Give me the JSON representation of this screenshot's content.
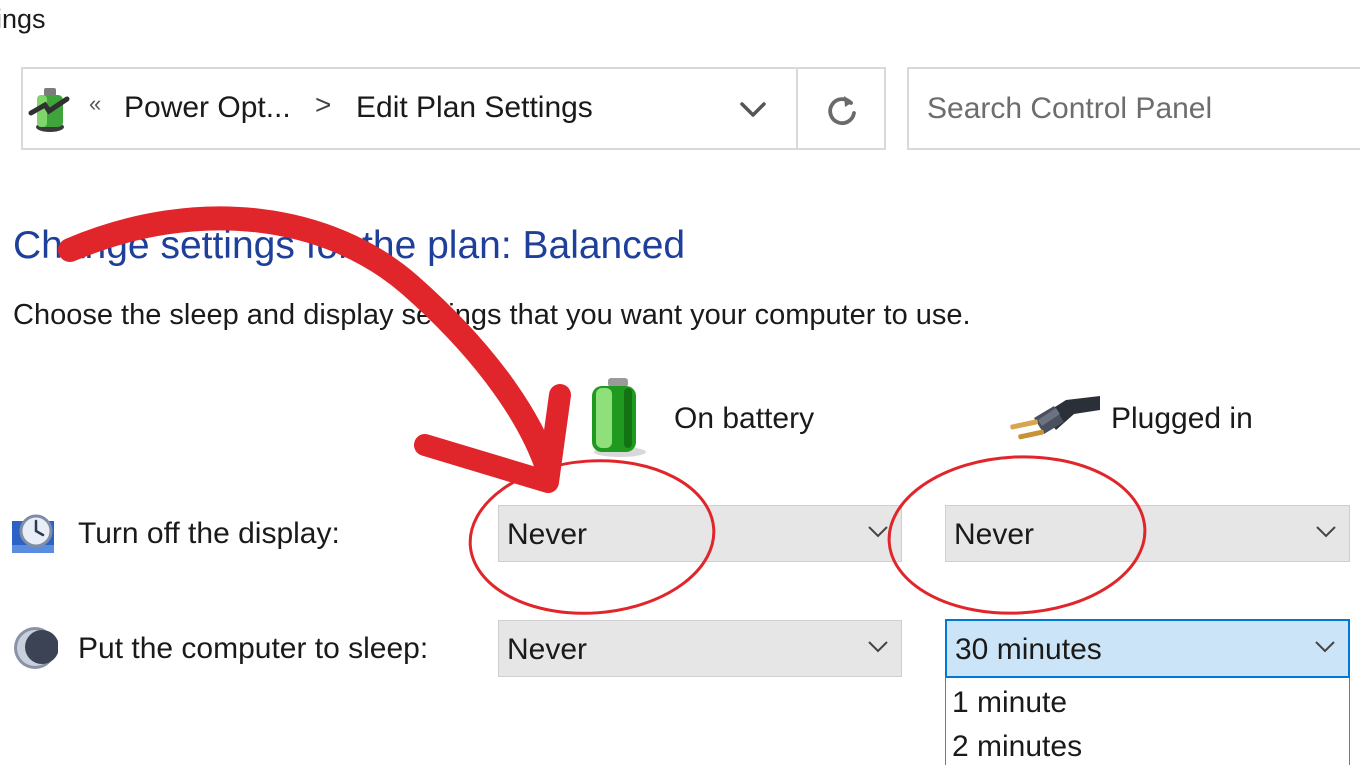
{
  "window": {
    "title_fragment": "ings"
  },
  "addressbar": {
    "back_chevron": "«",
    "crumbs": [
      "Power Opt...",
      "Edit Plan Settings"
    ],
    "crumb_separator": ">",
    "icon": "power-options-icon",
    "dropdown_icon": "chevron-down-icon",
    "refresh_icon": "refresh-icon"
  },
  "search": {
    "placeholder": "Search Control Panel"
  },
  "main": {
    "heading": "Change settings for the plan: Balanced",
    "subtext": "Choose the sleep and display settings that you want your computer to use.",
    "columns": {
      "battery": {
        "label": "On battery",
        "icon": "battery-icon"
      },
      "plugged": {
        "label": "Plugged in",
        "icon": "plug-icon"
      }
    },
    "rows": {
      "display": {
        "label": "Turn off the display:",
        "icon": "monitor-clock-icon",
        "battery_value": "Never",
        "plugged_value": "Never"
      },
      "sleep": {
        "label": "Put the computer to sleep:",
        "icon": "moon-icon",
        "battery_value": "Never",
        "plugged_value": "30 minutes"
      }
    },
    "dropdown_options": [
      "1 minute",
      "2 minutes"
    ]
  },
  "colors": {
    "heading": "#1e3f9a",
    "annotation": "#e0262b",
    "active_select": "#cce4f7",
    "accent": "#0078d7"
  }
}
